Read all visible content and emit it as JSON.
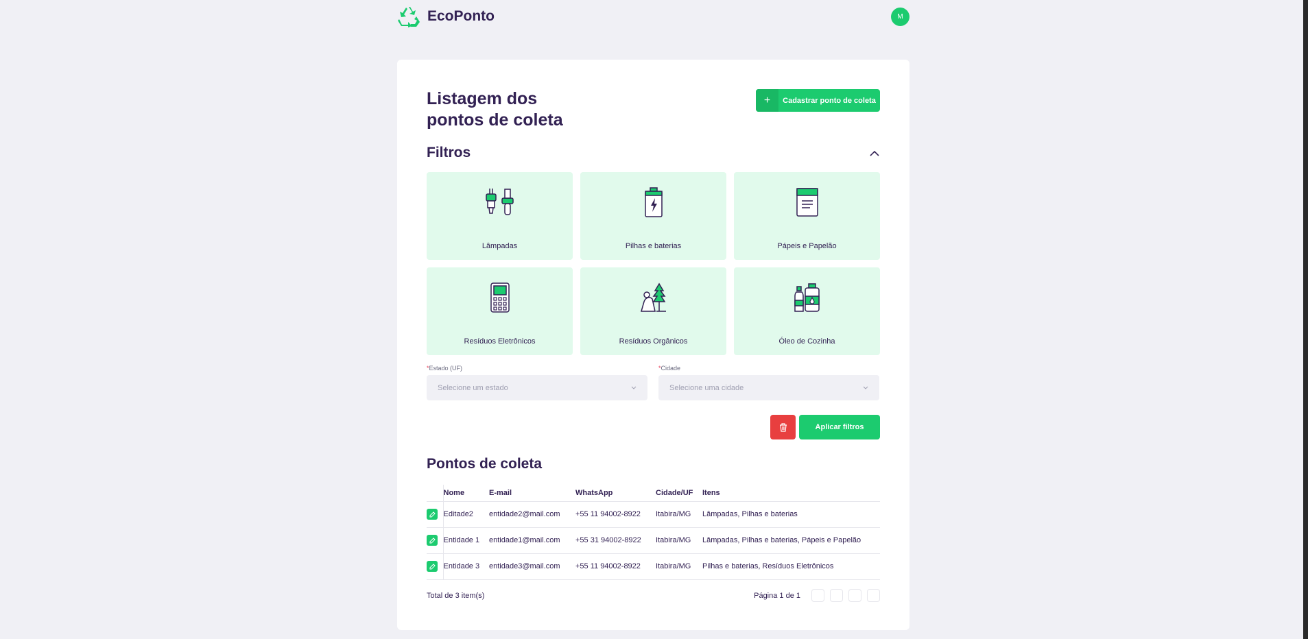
{
  "app": {
    "name": "EcoPonto",
    "avatar_initial": "M",
    "accent": "#1ccb6f",
    "danger": "#e83f3f"
  },
  "page": {
    "title": "Listagem dos pontos de coleta",
    "add_button": "Cadastrar ponto de coleta"
  },
  "filters": {
    "title": "Filtros",
    "items": [
      {
        "label": "Lâmpadas",
        "icon": "lamp-icon"
      },
      {
        "label": "Pilhas e baterias",
        "icon": "battery-icon"
      },
      {
        "label": "Pápeis e Papelão",
        "icon": "paper-icon"
      },
      {
        "label": "Resíduos Eletrônicos",
        "icon": "electronics-icon"
      },
      {
        "label": "Resíduos Orgânicos",
        "icon": "organic-icon"
      },
      {
        "label": "Óleo de Cozinha",
        "icon": "oil-icon"
      }
    ],
    "state": {
      "label": "Estado (UF)",
      "placeholder": "Selecione um estado"
    },
    "city": {
      "label": "Cidade",
      "placeholder": "Selecione uma cidade"
    },
    "apply": "Aplicar filtros"
  },
  "points": {
    "title": "Pontos de coleta",
    "columns": [
      "Nome",
      "E-mail",
      "WhatsApp",
      "Cidade/UF",
      "Itens"
    ],
    "rows": [
      {
        "name": "Editade2",
        "email": "entidade2@mail.com",
        "whatsapp": "+55 11 94002-8922",
        "city": "Itabira/MG",
        "items": "Lâmpadas, Pilhas e baterias"
      },
      {
        "name": "Entidade 1",
        "email": "entidade1@mail.com",
        "whatsapp": "+55 31 94002-8922",
        "city": "Itabira/MG",
        "items": "Lâmpadas, Pilhas e baterias, Pápeis e Papelão"
      },
      {
        "name": "Entidade 3",
        "email": "entidade3@mail.com",
        "whatsapp": "+55 11 94002-8922",
        "city": "Itabira/MG",
        "items": "Pilhas e baterias, Resíduos Eletrônicos"
      }
    ],
    "total": "Total de 3 item(s)",
    "page": "Página 1 de 1"
  }
}
